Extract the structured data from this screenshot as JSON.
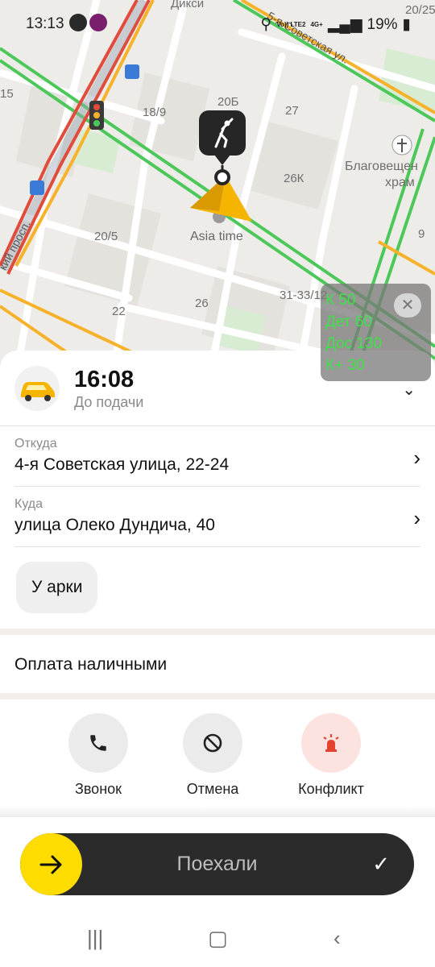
{
  "status_bar": {
    "time": "13:13",
    "battery": "19%",
    "volte": "Vo)) LTE2",
    "net": "4G+"
  },
  "map": {
    "labels": {
      "dixie": "Дикси",
      "street_sov5": "5-я Советская ул.",
      "h15": "15",
      "h18_9": "18/9",
      "h20b": "20Б",
      "h27": "27",
      "h20_25": "20/25",
      "blag1": "Благовещен",
      "blag2": "храм",
      "h26k": "26К",
      "asia": "Asia time",
      "h20_5": "20/5",
      "suv": "кий просп.",
      "h9": "9",
      "h31": "31-33/12",
      "h22": "22",
      "h26": "26"
    }
  },
  "overlay": {
    "lines": [
      "К 50",
      "Дет 60",
      "Дос 130",
      "К+ 30"
    ],
    "close": "✕"
  },
  "order": {
    "eta": "16:08",
    "eta_caption": "До подачи",
    "from_label": "Откуда",
    "from_value": "4-я Советская улица, 22-24",
    "to_label": "Куда",
    "to_value": "улица Олеко Дундича, 40",
    "comment": "У арки",
    "payment": "Оплата наличными"
  },
  "actions": {
    "call": "Звонок",
    "cancel": "Отмена",
    "conflict": "Конфликт"
  },
  "go_button": {
    "label": "Поехали"
  },
  "colors": {
    "accent_yellow": "#fedc00",
    "traffic_green": "#4cc85a",
    "traffic_red": "#e04b3c",
    "traffic_orange": "#f7b22b",
    "dark_bar": "#2b2b2b",
    "overlay_text": "#3fe04a"
  }
}
